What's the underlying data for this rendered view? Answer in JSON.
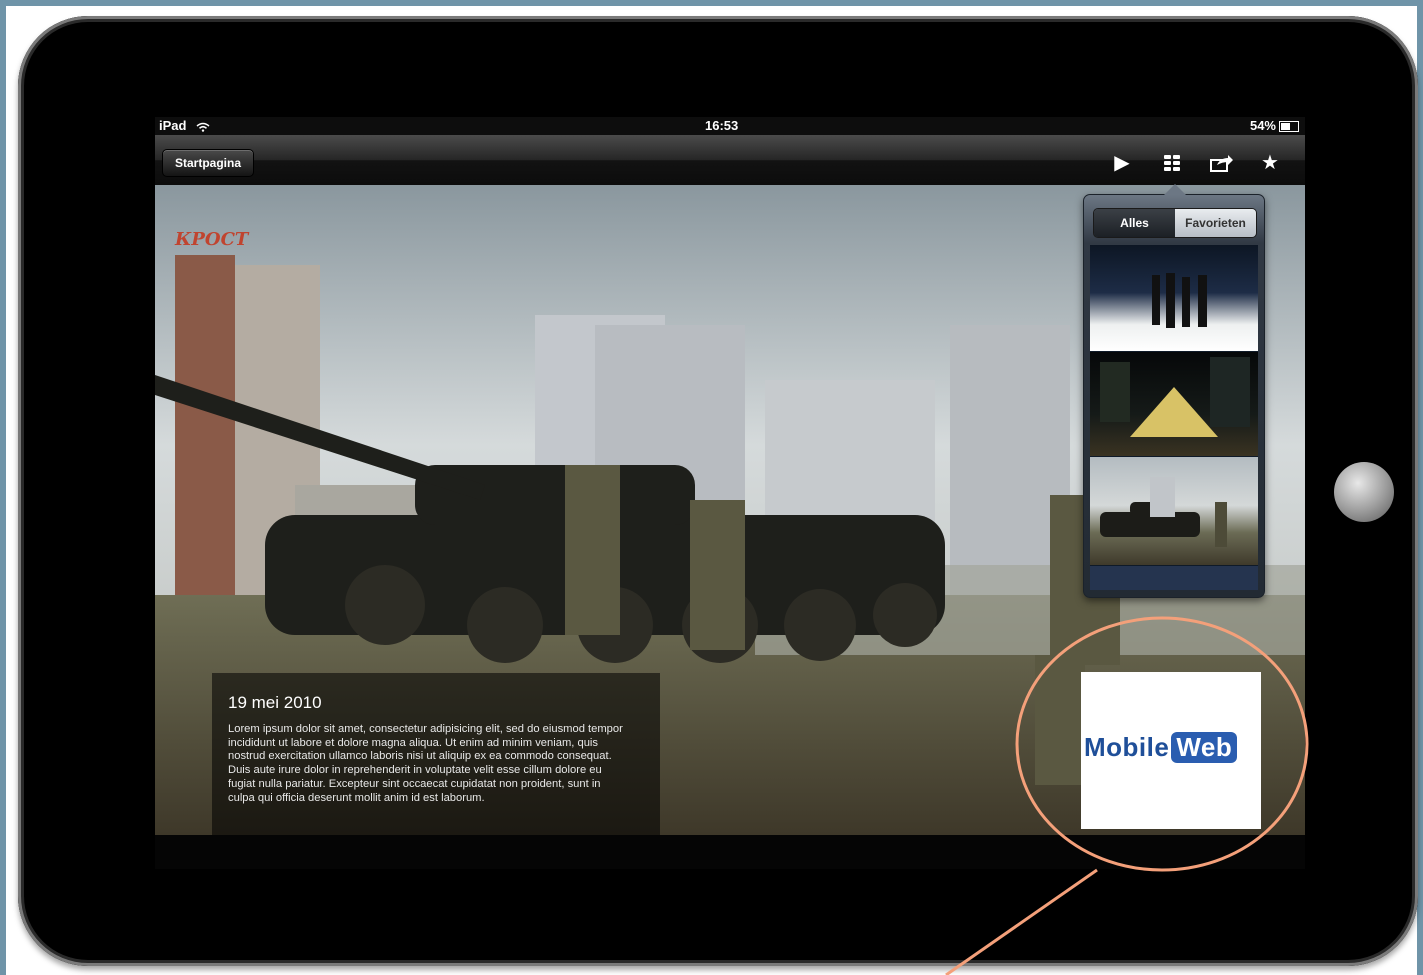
{
  "status_bar": {
    "device": "iPad",
    "time": "16:53",
    "battery": "54%"
  },
  "nav": {
    "back_label": "Startpagina"
  },
  "toolbar_icons": [
    "play-icon",
    "grid-icon",
    "share-icon",
    "star-icon"
  ],
  "popover": {
    "segments": [
      "Alles",
      "Favorieten"
    ],
    "selected": "Favorieten"
  },
  "caption": {
    "date": "19 mei 2010",
    "body": "Lorem ipsum dolor sit amet, consectetur adipisicing elit, sed do eiusmod tempor incididunt ut labore et dolore magna aliqua. Ut enim ad minim veniam, quis nostrud exercitation ullamco laboris nisi ut aliquip ex ea commodo consequat. Duis aute irure dolor in reprehenderit in voluptate velit esse cillum dolore eu fugiat nulla pariatur. Excepteur sint occaecat cupidatat non proident, sunt in culpa qui officia deserunt mollit anim id est laborum."
  },
  "photo_sign": "КРОСТ",
  "logo": {
    "part1": "Mobile",
    "part2": "Web"
  },
  "colors": {
    "annotation": "#f4a07a",
    "frame_bg": "#6f94a8",
    "logo_blue": "#1f4f99"
  }
}
